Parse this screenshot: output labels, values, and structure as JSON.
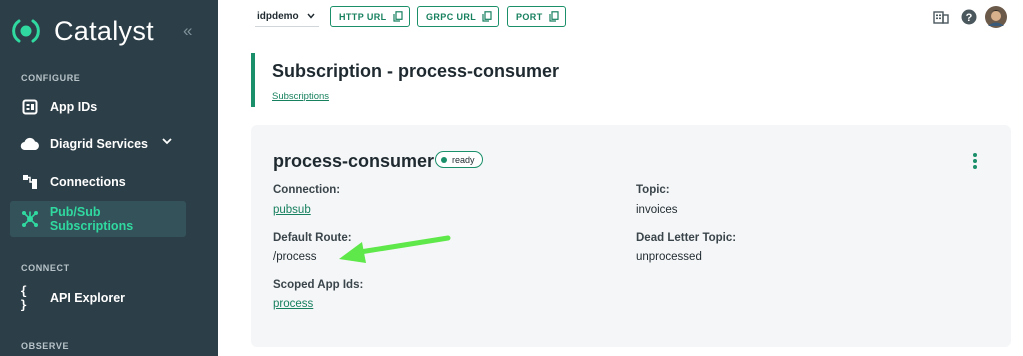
{
  "app": {
    "name": "Catalyst",
    "collapse_glyph": "«"
  },
  "sidebar": {
    "sections": [
      {
        "label": "CONFIGURE"
      },
      {
        "label": "CONNECT"
      },
      {
        "label": "OBSERVE"
      }
    ],
    "items": [
      {
        "label": "App IDs",
        "icon": "app-ids-icon"
      },
      {
        "label": "Diagrid Services",
        "icon": "cloud-icon"
      },
      {
        "label": "Connections",
        "icon": "connections-icon"
      },
      {
        "label": "Pub/Sub Subscriptions",
        "icon": "pubsub-icon",
        "active": true
      },
      {
        "label": "API Explorer",
        "icon": "braces-icon",
        "glyph": "{ }"
      }
    ]
  },
  "topbar": {
    "org": "idpdemo",
    "buttons": [
      {
        "label": "HTTP URL"
      },
      {
        "label": "GRPC URL"
      },
      {
        "label": "PORT"
      }
    ]
  },
  "page": {
    "title": "Subscription - process-consumer",
    "breadcrumb": "Subscriptions"
  },
  "card": {
    "title": "process-consumer",
    "status": "ready",
    "fields": {
      "connection": {
        "label": "Connection:",
        "value": "pubsub"
      },
      "topic": {
        "label": "Topic:",
        "value": "invoices"
      },
      "default_route": {
        "label": "Default Route:",
        "value": "/process"
      },
      "dead_letter_topic": {
        "label": "Dead Letter Topic:",
        "value": "unprocessed"
      },
      "scoped_app_ids": {
        "label": "Scoped App Ids:",
        "value": "process"
      }
    }
  },
  "colors": {
    "sidebar_bg": "#2c3e47",
    "accent": "#1a8f6a",
    "active_text": "#30d9a0",
    "annotation_arrow": "#5ee84a"
  }
}
